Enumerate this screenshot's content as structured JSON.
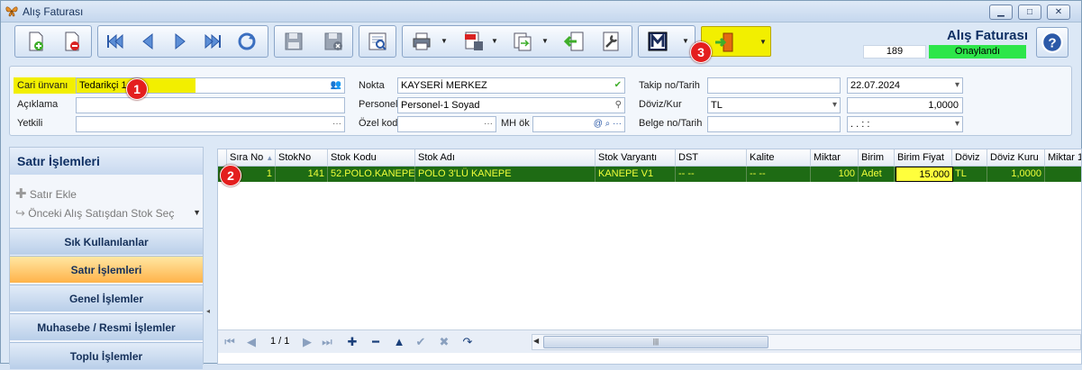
{
  "window": {
    "title": "Alış Faturası",
    "btn_min": "▁",
    "btn_max": "□",
    "btn_close": "✕"
  },
  "header": {
    "doc_title": "Alış Faturası",
    "doc_no": "189",
    "status": "Onaylandı",
    "status_color": "#2de64a"
  },
  "form": {
    "cari_unvani": {
      "label": "Cari ünvanı",
      "value": "Tedarikçi 1"
    },
    "aciklama": {
      "label": "Açıklama",
      "value": ""
    },
    "yetkili": {
      "label": "Yetkili",
      "value": ""
    },
    "nokta": {
      "label": "Nokta",
      "value": "KAYSERİ MERKEZ"
    },
    "personel": {
      "label": "Personel",
      "value": "Personel-1 Soyad"
    },
    "ozel_kod": {
      "label": "Özel kod",
      "value": ""
    },
    "mh_ok": {
      "label": "MH ök",
      "value": ""
    },
    "takip": {
      "label": "Takip no/Tarih",
      "value": "",
      "date": "22.07.2024"
    },
    "doviz": {
      "label": "Döviz/Kur",
      "value": "TL",
      "rate": "1,0000"
    },
    "belge": {
      "label": "Belge no/Tarih",
      "value": "",
      "date": ". .   : :"
    },
    "ellipsis": "···"
  },
  "badges": [
    "1",
    "2",
    "3"
  ],
  "left_panel": {
    "title": "Satır İşlemleri",
    "actions": [
      {
        "label": "Satır Ekle",
        "icon": "plus-icon"
      },
      {
        "label": "Önceki Alış Satışdan Stok Seç",
        "icon": "redo-icon"
      }
    ],
    "nav": [
      {
        "label": "Sık Kullanılanlar",
        "active": false
      },
      {
        "label": "Satır İşlemleri",
        "active": true
      },
      {
        "label": "Genel İşlemler",
        "active": false
      },
      {
        "label": "Muhasebe / Resmi İşlemler",
        "active": false
      },
      {
        "label": "Toplu İşlemler",
        "active": false
      }
    ]
  },
  "grid": {
    "columns": [
      "Sıra No",
      "StokNo",
      "Stok Kodu",
      "Stok Adı",
      "Stok Varyantı",
      "DST",
      "Kalite",
      "Miktar",
      "Birim",
      "Birim Fiyat",
      "Döviz",
      "Döviz Kuru",
      "Miktar 1"
    ],
    "rows": [
      [
        "1",
        "141",
        "52.POLO.KANEPE",
        "POLO 3'LÜ KANEPE",
        "KANEPE V1",
        "-- --",
        "-- --",
        "100",
        "Adet",
        "15.000",
        "TL",
        "1,0000",
        ""
      ]
    ],
    "pager": "1 / 1",
    "row_color": "#1e6b14"
  }
}
